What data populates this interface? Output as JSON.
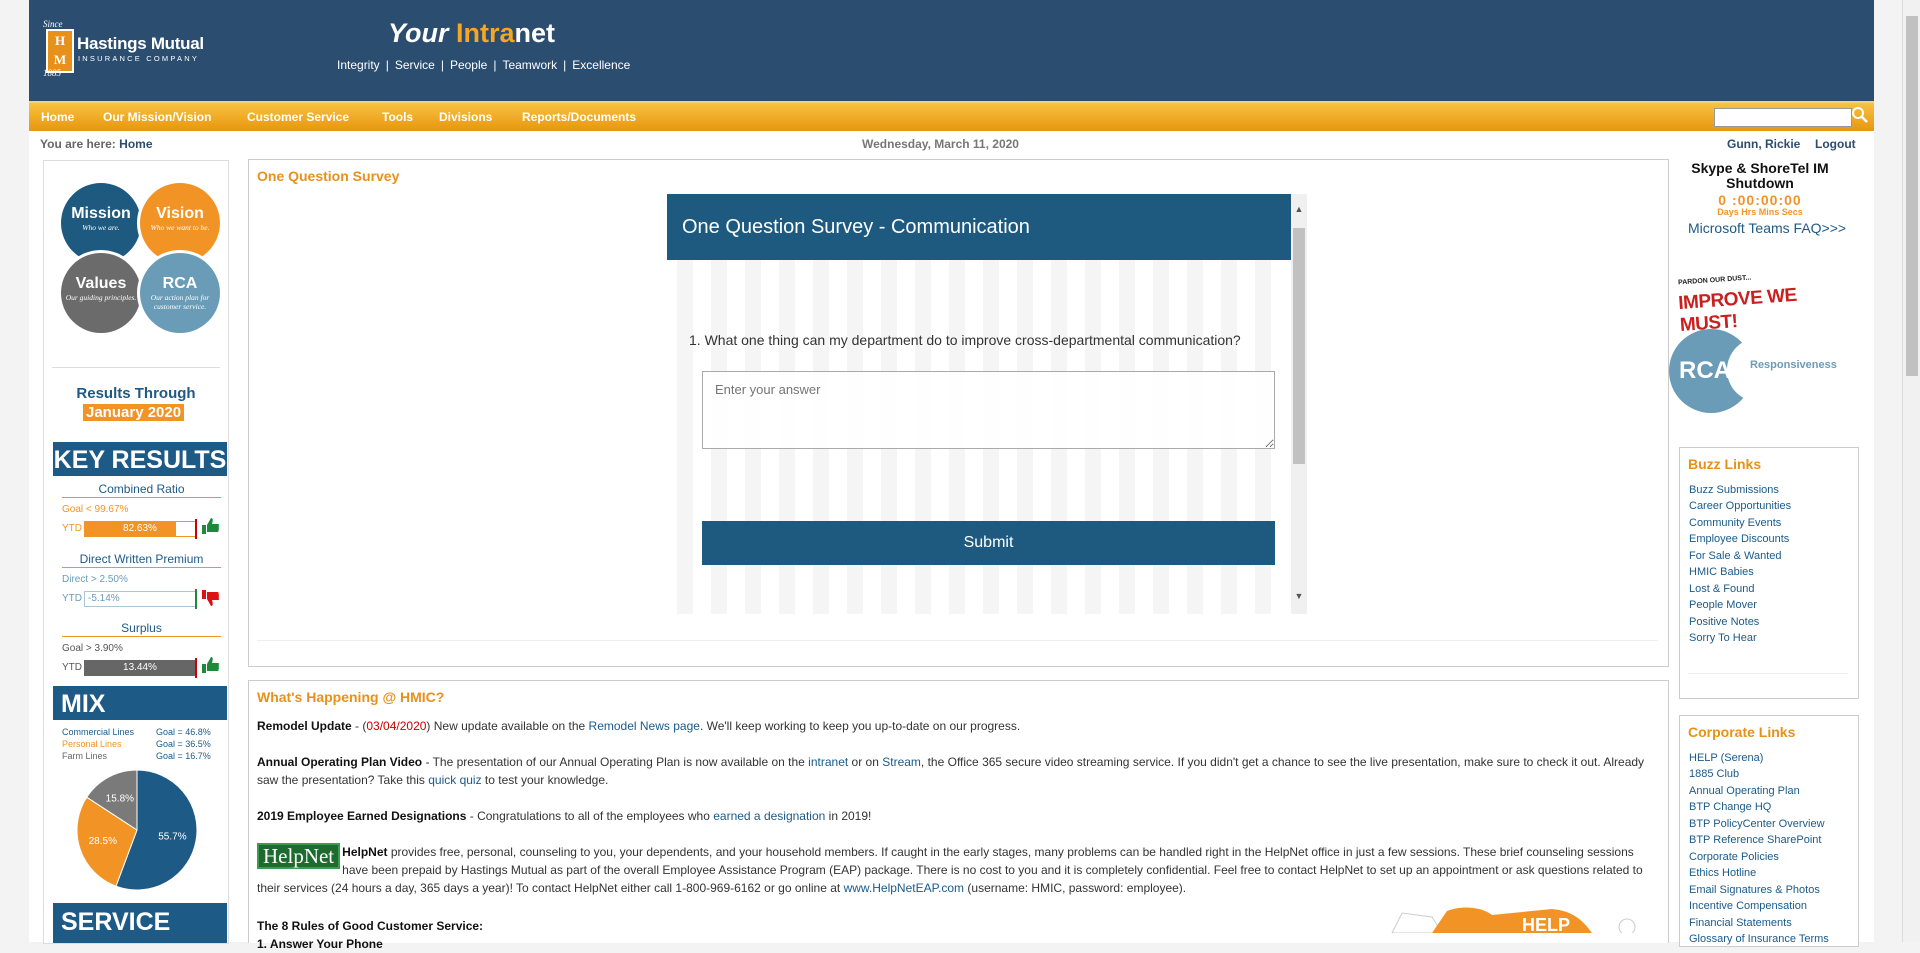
{
  "header": {
    "logo": {
      "since": "Since",
      "year": "1885",
      "initials": "H M",
      "name": "Hastings Mutual",
      "sub": "INSURANCE COMPANY"
    },
    "title_your": "Your ",
    "title_intra": "Intra",
    "title_net": "net",
    "values": [
      "Integrity",
      "Service",
      "People",
      "Teamwork",
      "Excellence"
    ]
  },
  "nav": {
    "items": [
      "Home",
      "Our Mission/Vision",
      "Customer Service",
      "Tools",
      "Divisions",
      "Reports/Documents"
    ],
    "search_placeholder": ""
  },
  "infobar": {
    "you_are_here": "You are here:",
    "crumb": "Home",
    "date": "Wednesday, March 11, 2020",
    "user": "Gunn, Rickie",
    "logout": "Logout"
  },
  "left": {
    "circles": [
      {
        "title": "Mission",
        "sub": "Who we are.",
        "color": "#1e5a80"
      },
      {
        "title": "Vision",
        "sub": "Who we want to be.",
        "color": "#f29425"
      },
      {
        "title": "Values",
        "sub": "Our guiding principles.",
        "color": "#6b6b6b"
      },
      {
        "title": "RCA",
        "sub": "Our action plan for customer service.",
        "color": "#6a9cb8"
      }
    ],
    "results_through": "Results Through",
    "results_month": "January 2020",
    "key_results": "KEY RESULTS",
    "metrics": [
      {
        "title": "Combined Ratio",
        "goal": "Goal < 99.67%",
        "ytd": "YTD",
        "value": "82.63%",
        "fill": 0.83,
        "thumb": "thumbs-up-icon"
      },
      {
        "title": "Direct Written Premium",
        "goal": "Direct > 2.50%",
        "ytd": "YTD",
        "value": "-5.14%",
        "fill": 0.0,
        "thumb": "thumbs-down-icon"
      },
      {
        "title": "Surplus",
        "goal": "Goal > 3.90%",
        "ytd": "YTD",
        "value": "13.44%",
        "fill": 1.0,
        "thumb": "thumbs-up-icon"
      }
    ],
    "mix": "MIX",
    "mix_rows": [
      {
        "label": "Commercial Lines",
        "goal": "Goal = 46.8%",
        "color": "#1e5a86"
      },
      {
        "label": "Personal Lines",
        "goal": "Goal = 36.5%",
        "color": "#f29425"
      },
      {
        "label": "Farm Lines",
        "goal": "Goal = 16.7%",
        "color": "#666666"
      }
    ],
    "service": "SERVICE"
  },
  "chart_data": {
    "type": "pie",
    "labels": [
      "Commercial Lines",
      "Personal Lines",
      "Farm Lines"
    ],
    "values": [
      55.7,
      28.5,
      15.8
    ],
    "value_labels": [
      "55.7%",
      "28.5%",
      "15.8%"
    ],
    "colors": [
      "#1e5a86",
      "#f29425",
      "#7a7a7a"
    ]
  },
  "survey_panel": {
    "title": "One Question Survey",
    "form_title": "One Question Survey - Communication",
    "question": "1. What one thing can my department do to improve cross-departmental communication?",
    "placeholder": "Enter your answer",
    "submit": "Submit"
  },
  "happening": {
    "title": "What's Happening @ HMIC?",
    "remodel": {
      "bold": "Remodel Update",
      "dash": " - (",
      "date": "03/04/2020",
      "mid": ") New update available on the ",
      "link": "Remodel News page",
      "end": ". We'll keep working to keep you up-to-date on our progress."
    },
    "aop": {
      "bold": "Annual Operating Plan Video",
      "t1": " - The presentation of our Annual Operating Plan is now available on the ",
      "l1": "intranet",
      "t2": " or on ",
      "l2": "Stream",
      "t3": ", the Office 365 secure video streaming service. If you didn't get a chance to see the live presentation, make sure to check it out. Already saw the presentation? Take this ",
      "l3": "quick quiz",
      "t4": " to test your knowledge."
    },
    "designations": {
      "bold": "2019 Employee Earned Designations",
      "t1": " - Congratulations to all of the employees who ",
      "l1": "earned a designation",
      "t2": " in 2019!"
    },
    "helpnet": {
      "logo": "HelpNet",
      "bold": "HelpNet",
      "t1": " provides free, personal, counseling to you, your dependents, and your household members. If caught in the early stages, many problems can be handled right in the HelpNet office in just a few sessions. These brief counseling sessions have been prepaid by Hastings Mutual as part of the overall Employee Assistance Program (EAP) package. There is no cost to you and it is completely confidential. Feel free to contact HelpNet to set up an appointment or ask questions related to their services (24 hours a day, 365 days a year)! To contact HelpNet either call 1-800-969-6162 or go online at ",
      "l1": "www.HelpNetEAP.com",
      "t2": " (username: HMIC, password: employee)."
    },
    "rules": "The 8 Rules of Good Customer Service:",
    "rule1": "1. Answer Your Phone"
  },
  "right": {
    "skype_title": "Skype & ShoreTel IM Shutdown",
    "timer": "0 :00:00:00",
    "timer_labels": "Days Hrs Mins Secs",
    "teams_faq": "Microsoft Teams FAQ>>>",
    "improve_small": "PARDON OUR DUST...",
    "improve_big": "IMPROVE WE MUST!",
    "rca": "RCA",
    "responsiveness": "Responsiveness",
    "buzz_title": "Buzz Links",
    "buzz_links": [
      "Buzz Submissions",
      "Career Opportunities",
      "Community Events",
      "Employee Discounts",
      "For Sale & Wanted",
      "HMIC Babies",
      "Lost & Found",
      "People Mover",
      "Positive Notes",
      "Sorry To Hear"
    ],
    "corp_title": "Corporate Links",
    "corp_links": [
      "HELP (Serena)",
      "1885 Club",
      "Annual Operating Plan",
      "BTP Change HQ",
      "BTP PolicyCenter Overview",
      "BTP Reference SharePoint",
      "Corporate Policies",
      "Ethics Hotline",
      "Email Signatures & Photos",
      "Incentive Compensation",
      "Financial Statements",
      "Glossary of Insurance Terms"
    ]
  }
}
